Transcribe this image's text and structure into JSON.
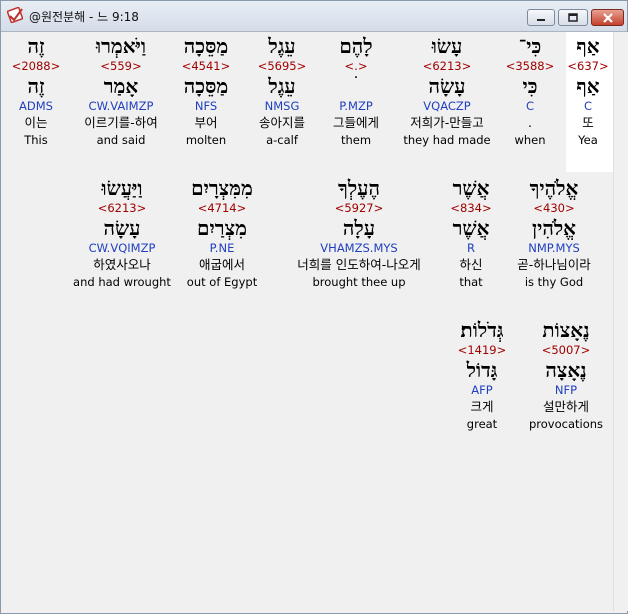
{
  "window": {
    "title": "@원전분해 - 느 9:18",
    "icon": "app-check-icon",
    "controls": {
      "minimize": "minimize-icon",
      "maximize": "maximize-icon",
      "close": "close-icon"
    }
  },
  "rows": [
    {
      "words": [
        {
          "hebrew": "אַף",
          "strong": "<637>",
          "lemma": "אַף",
          "parse": "C",
          "korean": "또",
          "english": "Yea"
        },
        {
          "hebrew": "כִּי־",
          "strong": "<3588>",
          "lemma": "כִּי",
          "parse": "C",
          "korean": ".",
          "english": "when"
        },
        {
          "hebrew": "עָשׂוּ",
          "strong": "<6213>",
          "lemma": "עָשָׂה",
          "parse": "VQACZP",
          "korean": "저희가-만들고",
          "english": "they had made"
        },
        {
          "hebrew": "לָהֶם",
          "strong": "<.>",
          "lemma": "ׄ",
          "parse": "P.MZP",
          "korean": "그들에게",
          "english": "them"
        },
        {
          "hebrew": "עֵגֶל",
          "strong": "<5695>",
          "lemma": "עֵגֶל",
          "parse": "NMSG",
          "korean": "송아지를",
          "english": "a-calf"
        },
        {
          "hebrew": "מַסֵּכָה",
          "strong": "<4541>",
          "lemma": "מַסֵּכָה",
          "parse": "NFS",
          "korean": "부어",
          "english": "molten"
        },
        {
          "hebrew": "וַיֹּאמְרוּ",
          "strong": "<559>",
          "lemma": "אָמַר",
          "parse": "CW.VAIMZP",
          "korean": "이르기를-하여",
          "english": "and said"
        },
        {
          "hebrew": "זֶה",
          "strong": "<2088>",
          "lemma": "זֶה",
          "parse": "ADMS",
          "korean": "이는",
          "english": "This"
        }
      ]
    },
    {
      "words": [
        {
          "hebrew": "אֱלֹהֶיךָ",
          "strong": "<430>",
          "lemma": "אֱלֹהִין",
          "parse": "NMP.MYS",
          "korean": "곧-하나님이라",
          "english": "is thy God"
        },
        {
          "hebrew": "אֲשֶׁר",
          "strong": "<834>",
          "lemma": "אֲשֶׁר",
          "parse": "R",
          "korean": "하신",
          "english": "that"
        },
        {
          "hebrew": "הֶעֶלְךָ",
          "strong": "<5927>",
          "lemma": "עָלָה",
          "parse": "VHAMZS.MYS",
          "korean": "너희를 인도하여-나오게",
          "english": "brought thee up"
        },
        {
          "hebrew": "מִמִּצְרָיִם",
          "strong": "<4714>",
          "lemma": "מִצְרַיִם",
          "parse": "P.NE",
          "korean": "애굽에서",
          "english": "out of Egypt"
        },
        {
          "hebrew": "וַיַּעֲשׂוּ",
          "strong": "<6213>",
          "lemma": "עָשָׂה",
          "parse": "CW.VQIMZP",
          "korean": "하였사오나",
          "english": "and had wrought"
        }
      ]
    },
    {
      "words": [
        {
          "hebrew": "נֶאָצוֹת",
          "strong": "<5007>",
          "lemma": "נֶאָצָה",
          "parse": "NFP",
          "korean": "설만하게",
          "english": "provocations"
        },
        {
          "hebrew": "גְּדֹלוֹת׃",
          "strong": "<1419>",
          "lemma": "גָּדוֹל",
          "parse": "AFP",
          "korean": "크게",
          "english": "great"
        }
      ]
    }
  ]
}
